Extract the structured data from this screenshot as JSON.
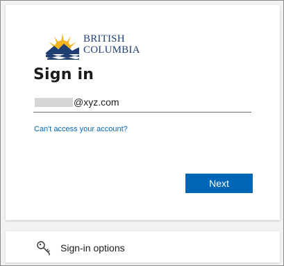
{
  "logo": {
    "line1": "BRITISH",
    "line2": "COLUMBIA"
  },
  "signin": {
    "title": "Sign in",
    "email_suffix": "@xyz.com",
    "cant_access_link": "Can't access your account?",
    "next_label": "Next"
  },
  "options": {
    "label": "Sign-in options",
    "icon": "key-icon"
  },
  "colors": {
    "accent": "#0067b8",
    "logo_navy": "#1f3f72",
    "logo_gold": "#f2b51f"
  }
}
